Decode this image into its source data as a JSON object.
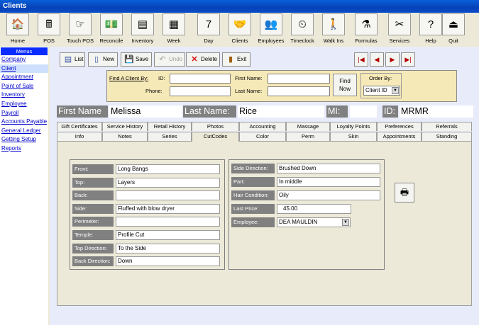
{
  "window": {
    "title": "Clients"
  },
  "toolbar": [
    {
      "label": "Home",
      "icon": "house-icon",
      "glyph": "🏠"
    },
    {
      "label": "POS",
      "icon": "cash-register-icon",
      "glyph": "🖩"
    },
    {
      "label": "Touch POS",
      "icon": "pointing-hand-icon",
      "glyph": "☞"
    },
    {
      "label": "Reconcile",
      "icon": "money-icon",
      "glyph": "💵"
    },
    {
      "label": "Inventory",
      "icon": "inventory-icon",
      "glyph": "▤"
    },
    {
      "label": "Week",
      "icon": "week-calendar-icon",
      "glyph": "▦"
    },
    {
      "label": "Day",
      "icon": "day-calendar-icon",
      "glyph": "7"
    },
    {
      "label": "Clients",
      "icon": "handshake-icon",
      "glyph": "🤝"
    },
    {
      "label": "Employees",
      "icon": "people-icon",
      "glyph": "👥"
    },
    {
      "label": "Timeclock",
      "icon": "timeclock-icon",
      "glyph": "⏲"
    },
    {
      "label": "Walk Ins",
      "icon": "walk-in-icon",
      "glyph": "🚶"
    },
    {
      "label": "Formulas",
      "icon": "test-tube-icon",
      "glyph": "⚗"
    },
    {
      "label": "Services",
      "icon": "scissors-icon",
      "glyph": "✂"
    },
    {
      "label": "Help",
      "icon": "help-icon",
      "glyph": "?"
    },
    {
      "label": "Quit",
      "icon": "quit-door-icon",
      "glyph": "⏏"
    }
  ],
  "sidebar": {
    "header": "Menus",
    "items": [
      "Company",
      "Client",
      "Appointment",
      "Point of Sale",
      "Inventory",
      "Employee",
      "Payroll",
      "Accounts Payable",
      "General Ledger",
      "Getting Setup",
      "Reports"
    ]
  },
  "commands": {
    "list": "List",
    "new": "New",
    "save": "Save",
    "undo": "Undo",
    "delete": "Delete",
    "exit": "Exit"
  },
  "find": {
    "title": "Find A Client By:",
    "id_label": "ID:",
    "phone_label": "Phone:",
    "first_name_label": "First Name:",
    "last_name_label": "Last Name:",
    "find_now": "Find Now",
    "order_by_label": "Order By:",
    "order_by_value": "Client ID"
  },
  "client": {
    "first_name_label": "First Name",
    "first_name": "Melissa",
    "last_name_label": "Last Name:",
    "last_name": "Rice",
    "mi_label": "MI:",
    "mi": "",
    "id_label": "ID:",
    "id": "MRMR"
  },
  "tabs_row1": [
    "Gift Certificates",
    "Service History",
    "Retail History",
    "Photos",
    "Accounting",
    "Massage",
    "Loyalty Points",
    "Preferences",
    "Referrals"
  ],
  "tabs_row2": [
    "Info",
    "Notes",
    "Series",
    "CutCodes",
    "Color",
    "Perm",
    "Skin",
    "Appointments",
    "Standing"
  ],
  "active_tab": "CutCodes",
  "cutcodes_left": [
    {
      "label": "Front:",
      "value": "Long Bangs"
    },
    {
      "label": "Top:",
      "value": "Layers"
    },
    {
      "label": "Back:",
      "value": ""
    },
    {
      "label": "Side:",
      "value": "Fluffed with blow dryer"
    },
    {
      "label": "Perimeter:",
      "value": ""
    },
    {
      "label": "Temple:",
      "value": "Profile Cut"
    },
    {
      "label": "Top Direction:",
      "value": "To the Side"
    },
    {
      "label": "Back Direction:",
      "value": "Down"
    }
  ],
  "cutcodes_right": [
    {
      "label": "Side Direction:",
      "value": "Brushed Down"
    },
    {
      "label": "Part:",
      "value": "In middle"
    },
    {
      "label": "Hair Condition:",
      "value": "Oily"
    },
    {
      "label": "Last Price:",
      "value": "45.00"
    },
    {
      "label": "Employee:",
      "value": "DEA MAULDIN"
    }
  ]
}
